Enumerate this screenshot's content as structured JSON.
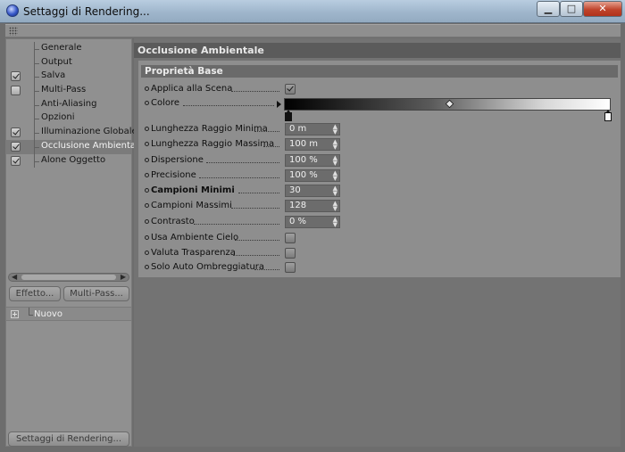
{
  "window": {
    "title": "Settaggi di Rendering...",
    "min_label": "▁",
    "max_label": "□",
    "close_label": "✕"
  },
  "sidebar": {
    "items": [
      {
        "label": "Generale",
        "checkbox": false,
        "checked": false,
        "selected": false
      },
      {
        "label": "Output",
        "checkbox": false,
        "checked": false,
        "selected": false
      },
      {
        "label": "Salva",
        "checkbox": true,
        "checked": true,
        "selected": false
      },
      {
        "label": "Multi-Pass",
        "checkbox": true,
        "checked": false,
        "selected": false
      },
      {
        "label": "Anti-Aliasing",
        "checkbox": false,
        "checked": false,
        "selected": false
      },
      {
        "label": "Opzioni",
        "checkbox": false,
        "checked": false,
        "selected": false
      },
      {
        "label": "Illuminazione Globale",
        "checkbox": true,
        "checked": true,
        "selected": false
      },
      {
        "label": "Occlusione Ambientale",
        "checkbox": true,
        "checked": true,
        "selected": true
      },
      {
        "label": "Alone Oggetto",
        "checkbox": true,
        "checked": true,
        "selected": false
      }
    ],
    "effetto_label": "Effetto...",
    "multipass_label": "Multi-Pass...",
    "new_item_label": "Nuovo",
    "bottom_button_label": "Settaggi di Rendering..."
  },
  "main": {
    "section_title": "Occlusione Ambientale",
    "group_title": "Proprietà Base",
    "props": {
      "applica": {
        "label": "Applica alla Scena",
        "checked": true
      },
      "colore": {
        "label": "Colore"
      },
      "raggio_min": {
        "label": "Lunghezza Raggio Minima",
        "value": "0 m"
      },
      "raggio_max": {
        "label": "Lunghezza Raggio Massima",
        "value": "100 m"
      },
      "dispersione": {
        "label": "Dispersione",
        "value": "100 %"
      },
      "precisione": {
        "label": "Precisione",
        "value": "100 %"
      },
      "campioni_min": {
        "label": "Campioni Minimi",
        "value": "30"
      },
      "campioni_max": {
        "label": "Campioni Massimi",
        "value": "128"
      },
      "contrasto": {
        "label": "Contrasto",
        "value": "0 %"
      },
      "ambiente_cielo": {
        "label": "Usa Ambiente Cielo",
        "checked": false
      },
      "trasparenza": {
        "label": "Valuta Trasparenza",
        "checked": false
      },
      "auto_ombreggiatura": {
        "label": "Solo Auto Ombreggiatura",
        "checked": false
      }
    }
  },
  "colors": {
    "panel": "#909090",
    "selected_item": "#7b7b7b",
    "section_header": "#5b5b5b",
    "field_bg": "#6c6c6c"
  }
}
